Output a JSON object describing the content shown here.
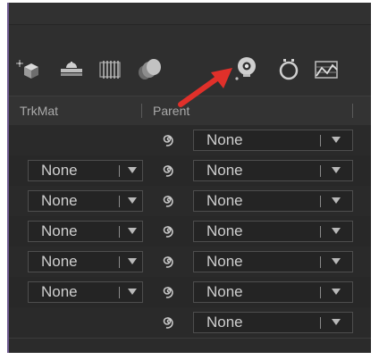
{
  "header": {
    "trkmat_label": "TrkMat",
    "parent_label": "Parent"
  },
  "toolbar": {
    "icons": [
      "3d-layer-icon",
      "adjustment-layer-icon",
      "motion-blur-icon",
      "frame-blending-icon",
      "light-bulb-icon",
      "stopwatch-icon",
      "graph-icon"
    ],
    "highlight_arrow_color": "#e0302a"
  },
  "layers": [
    {
      "trkmat": null,
      "parent": "None"
    },
    {
      "trkmat": "None",
      "parent": "None"
    },
    {
      "trkmat": "None",
      "parent": "None"
    },
    {
      "trkmat": "None",
      "parent": "None"
    },
    {
      "trkmat": "None",
      "parent": "None"
    },
    {
      "trkmat": "None",
      "parent": "None"
    },
    {
      "trkmat": null,
      "parent": "None"
    }
  ],
  "colors": {
    "panel_bg": "#2b2b2b",
    "text": "#cfcfcf",
    "accent_border": "#6d5a8e"
  }
}
